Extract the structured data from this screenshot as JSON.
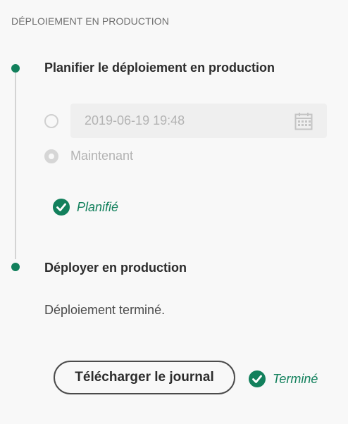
{
  "section_title": "DÉPLOIEMENT EN PRODUCTION",
  "step1": {
    "title": "Planifier le déploiement en production",
    "schedule_option": {
      "date_value": "2019-06-19 19:48",
      "icon": "calendar-icon",
      "selected": false
    },
    "now_option": {
      "label": "Maintenant",
      "selected": true
    },
    "status": {
      "icon": "check-circle-icon",
      "label": "Planifié"
    }
  },
  "step2": {
    "title": "Déployer en production",
    "message": "Déploiement terminé.",
    "download_button": "Télécharger le journal",
    "status": {
      "icon": "check-circle-icon",
      "label": "Terminé"
    }
  },
  "colors": {
    "accent": "#12805c",
    "line": "#d4d4d4",
    "disabled_text": "#b3b3b3"
  }
}
